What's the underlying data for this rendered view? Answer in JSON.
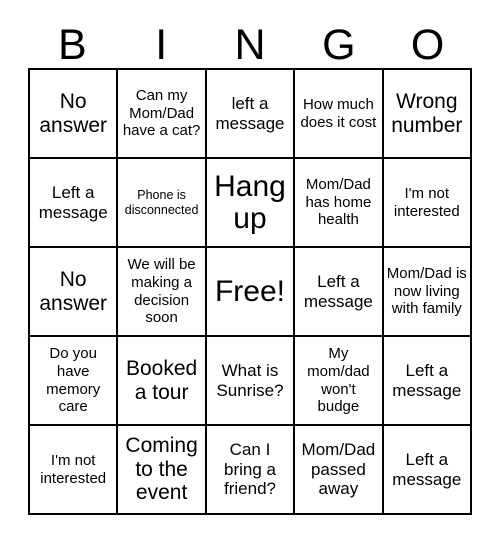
{
  "card": {
    "title_letters": [
      "B",
      "I",
      "N",
      "G",
      "O"
    ],
    "columns": 5,
    "rows": 5,
    "free_space_label": "Free!",
    "free_space_position": {
      "row": 3,
      "column": 3
    },
    "border_color": "#000000",
    "background_color": "#ffffff",
    "text_color": "#000000",
    "cells": [
      [
        {
          "text": "No answer",
          "size": "lg"
        },
        {
          "text": "Can my Mom/Dad have a cat?",
          "size": "sm"
        },
        {
          "text": "left a message",
          "size": "md"
        },
        {
          "text": "How much does it cost",
          "size": "sm"
        },
        {
          "text": "Wrong number",
          "size": "lg"
        }
      ],
      [
        {
          "text": "Left a message",
          "size": "md"
        },
        {
          "text": "Phone is disconnected",
          "size": "xs"
        },
        {
          "text": "Hang up",
          "size": "xl"
        },
        {
          "text": "Mom/Dad has home health",
          "size": "sm"
        },
        {
          "text": "I'm not interested",
          "size": "sm"
        }
      ],
      [
        {
          "text": "No answer",
          "size": "lg"
        },
        {
          "text": "We will be making a decision soon",
          "size": "sm"
        },
        {
          "text": "Free!",
          "size": "xl"
        },
        {
          "text": "Left a message",
          "size": "md"
        },
        {
          "text": "Mom/Dad is now living with family",
          "size": "sm"
        }
      ],
      [
        {
          "text": "Do you have memory care",
          "size": "sm"
        },
        {
          "text": "Booked a tour",
          "size": "lg"
        },
        {
          "text": "What is Sunrise?",
          "size": "md"
        },
        {
          "text": "My mom/dad won't budge",
          "size": "sm"
        },
        {
          "text": "Left a message",
          "size": "md"
        }
      ],
      [
        {
          "text": "I'm not interested",
          "size": "sm"
        },
        {
          "text": "Coming to the event",
          "size": "lg"
        },
        {
          "text": "Can I bring a friend?",
          "size": "md"
        },
        {
          "text": "Mom/Dad passed away",
          "size": "md"
        },
        {
          "text": "Left a message",
          "size": "md"
        }
      ]
    ]
  }
}
